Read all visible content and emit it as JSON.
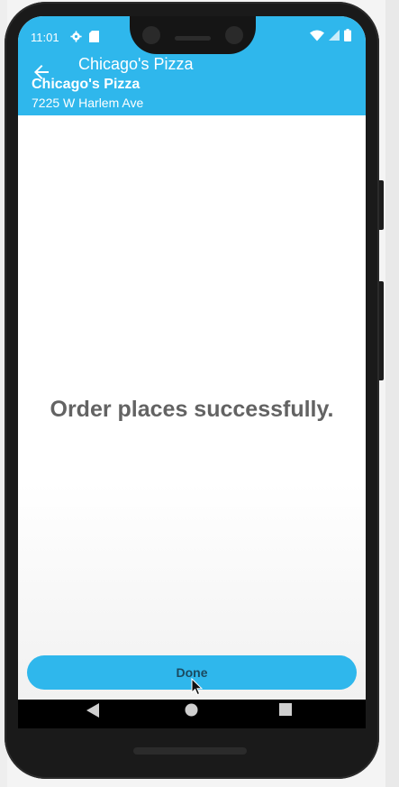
{
  "status_bar": {
    "time": "11:01",
    "left_icons": [
      "gear-icon",
      "sd-card-icon"
    ],
    "right_icons": [
      "wifi-icon",
      "signal-icon",
      "battery-icon"
    ]
  },
  "app_bar": {
    "title": "Chicago's Pizza",
    "restaurant_name": "Chicago's Pizza",
    "address": "7225 W Harlem Ave"
  },
  "main": {
    "message": "Order places successfully.",
    "done_label": "Done"
  },
  "nav_bar": {
    "icons": [
      "nav-back-icon",
      "nav-home-icon",
      "nav-recents-icon"
    ]
  },
  "colors": {
    "accent": "#2fb7ec",
    "message_text": "#636363",
    "button_text": "#1b4a60"
  }
}
